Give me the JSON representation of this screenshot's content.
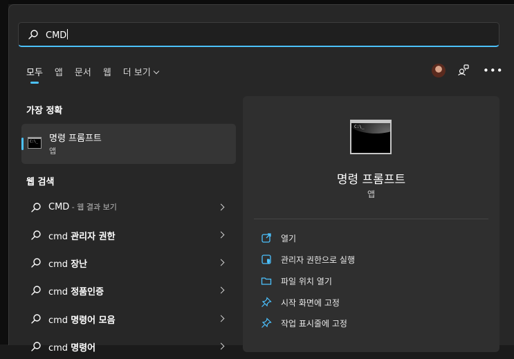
{
  "search": {
    "value": "CMD"
  },
  "filters": [
    {
      "label": "모두"
    },
    {
      "label": "앱"
    },
    {
      "label": "문서"
    },
    {
      "label": "웹"
    },
    {
      "label": "더 보기"
    }
  ],
  "best_match": {
    "section_title": "가장 정확",
    "name": "명령 프롬프트",
    "type": "앱"
  },
  "web_search": {
    "section_title": "웹 검색",
    "items": [
      {
        "query": "CMD",
        "suffix": " - 웹 결과 보기"
      },
      {
        "query": "cmd",
        "bold": "관리자 권한"
      },
      {
        "query": "cmd",
        "bold": "장난"
      },
      {
        "query": "cmd",
        "bold": "정품인증"
      },
      {
        "query": "cmd",
        "bold": "명령어 모음"
      },
      {
        "query": "cmd",
        "bold": "명령어"
      }
    ]
  },
  "preview": {
    "name": "명령 프롬프트",
    "type": "앱",
    "actions": [
      {
        "label": "열기",
        "icon": "open-icon"
      },
      {
        "label": "관리자 권한으로 실행",
        "icon": "shield-run-icon"
      },
      {
        "label": "파일 위치 열기",
        "icon": "folder-icon"
      },
      {
        "label": "시작 화면에 고정",
        "icon": "pin-icon"
      },
      {
        "label": "작업 표시줄에 고정",
        "icon": "pin-icon"
      }
    ]
  },
  "colors": {
    "accent": "#4cc2ff",
    "panel": "#272727",
    "preview": "#2f2f2f"
  }
}
